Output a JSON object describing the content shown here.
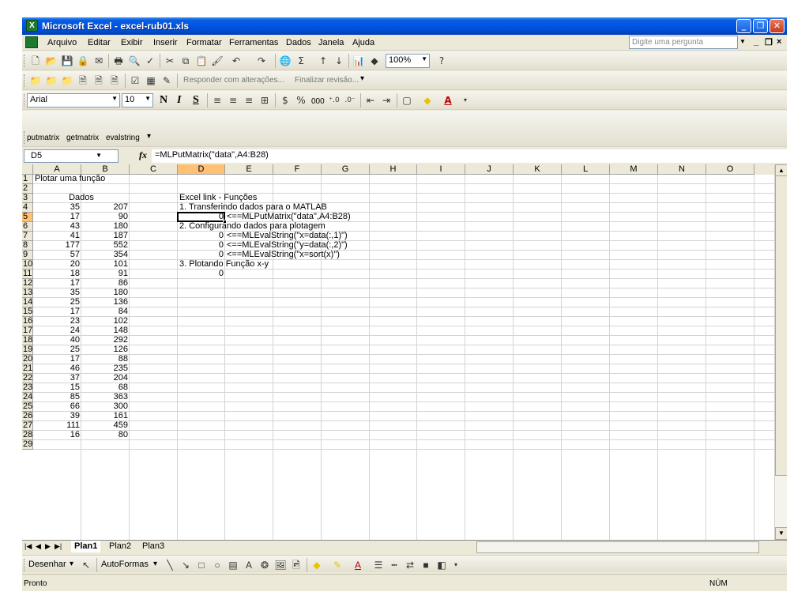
{
  "window": {
    "title": "Microsoft Excel - excel-rub01.xls",
    "minimize_icon": "minimize-icon",
    "maximize_icon": "restore-icon",
    "close_icon": "close-icon"
  },
  "menu": {
    "items": [
      "Arquivo",
      "Editar",
      "Exibir",
      "Inserir",
      "Formatar",
      "Ferramentas",
      "Dados",
      "Janela",
      "Ajuda"
    ],
    "help_placeholder": "Digite uma pergunta"
  },
  "toolbar_standard": {
    "zoom": "100%"
  },
  "toolbar_review": {
    "reply_label": "Responder com alterações...",
    "end_review_label": "Finalizar revisão..."
  },
  "toolbar_format": {
    "font": "Arial",
    "size": "10",
    "bold": "N",
    "italic": "I",
    "underline": "S",
    "thousands": "000"
  },
  "toolbar_excellink": {
    "buttons": [
      "putmatrix",
      "getmatrix",
      "evalstring"
    ]
  },
  "formula_bar": {
    "name_box": "D5",
    "fx": "fx",
    "formula": "=MLPutMatrix(\"data\",A4:B28)"
  },
  "columns": [
    "A",
    "B",
    "C",
    "D",
    "E",
    "F",
    "G",
    "H",
    "I",
    "J",
    "K",
    "L",
    "M",
    "N",
    "O"
  ],
  "rows": [
    "1",
    "2",
    "3",
    "4",
    "5",
    "6",
    "7",
    "8",
    "9",
    "10",
    "11",
    "12",
    "13",
    "14",
    "15",
    "16",
    "17",
    "18",
    "19",
    "20",
    "21",
    "22",
    "23",
    "24",
    "25",
    "26",
    "27",
    "28",
    "29"
  ],
  "cells": {
    "A1": "Plotar uma função",
    "A3": "Dados",
    "D3": "Excel link - Funções",
    "D4": "1. Transferindo dados para o MATLAB",
    "D5": "0",
    "E5": "<==MLPutMatrix(\"data\",A4:B28)",
    "D6": "2. Configurando dados para plotagem",
    "D7": "0",
    "E7": "<==MLEvalString(\"x=data(:,1)\")",
    "D8": "0",
    "E8": "<==MLEvalString(\"y=data(:,2)\")",
    "D9": "0",
    "E9": "<==MLEvalString(\"x=sort(x)\")",
    "D10": "3. Plotando Função x-y",
    "D11": "0"
  },
  "data_table": [
    [
      "35",
      "207"
    ],
    [
      "17",
      "90"
    ],
    [
      "43",
      "180"
    ],
    [
      "41",
      "187"
    ],
    [
      "177",
      "552"
    ],
    [
      "57",
      "354"
    ],
    [
      "20",
      "101"
    ],
    [
      "18",
      "91"
    ],
    [
      "17",
      "86"
    ],
    [
      "35",
      "180"
    ],
    [
      "25",
      "136"
    ],
    [
      "17",
      "84"
    ],
    [
      "23",
      "102"
    ],
    [
      "24",
      "148"
    ],
    [
      "40",
      "292"
    ],
    [
      "25",
      "126"
    ],
    [
      "17",
      "88"
    ],
    [
      "46",
      "235"
    ],
    [
      "37",
      "204"
    ],
    [
      "15",
      "68"
    ],
    [
      "85",
      "363"
    ],
    [
      "66",
      "300"
    ],
    [
      "39",
      "161"
    ],
    [
      "111",
      "459"
    ],
    [
      "16",
      "80"
    ]
  ],
  "sheets": [
    "Plan1",
    "Plan2",
    "Plan3"
  ],
  "active_sheet": "Plan1",
  "drawing_toolbar": {
    "draw_label": "Desenhar",
    "autoshapes_label": "AutoFormas"
  },
  "status": {
    "left": "Pronto",
    "right": "NÚM"
  }
}
